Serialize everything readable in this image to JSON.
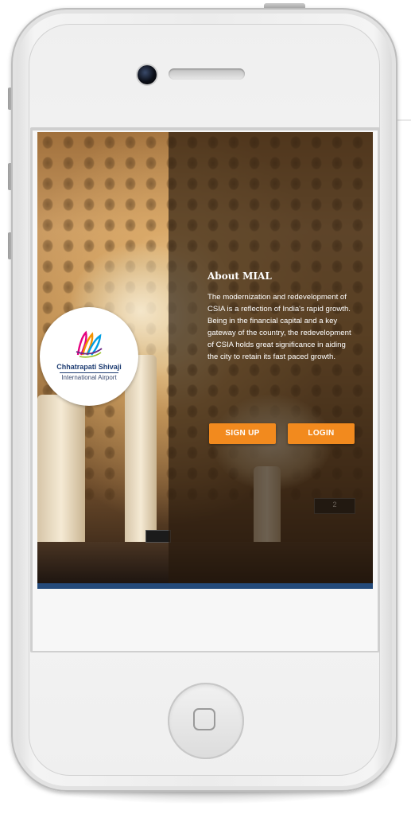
{
  "logo": {
    "name": "Chhatrapati Shivaji",
    "subtitle": "International Airport",
    "mark_colors": [
      "#e5007e",
      "#f39200",
      "#009fe3",
      "#6c2a86",
      "#95c11f"
    ]
  },
  "about": {
    "title": "About MIAL",
    "body": "The modernization and redevelopment of CSIA is a reflection of India's rapid growth. Being in the financial capital and a key gateway of the country, the redevelopment of CSIA holds great significance in aiding the city to retain its fast paced growth."
  },
  "buttons": {
    "signup_label": "SIGN UP",
    "login_label": "LOGIN"
  },
  "colors": {
    "accent": "#f28a1e",
    "bottom_bar": "#244a7a",
    "logo_text": "#1d3c72"
  },
  "signage": {
    "gate_number": "2"
  }
}
